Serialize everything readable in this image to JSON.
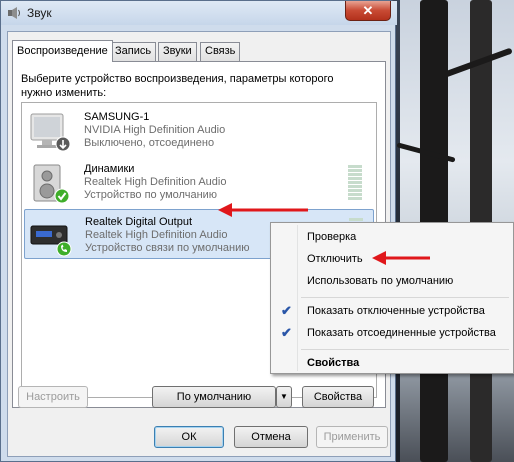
{
  "window": {
    "title": "Звук",
    "close_glyph": "✕"
  },
  "tabs": [
    {
      "label": "Воспроизведение"
    },
    {
      "label": "Запись"
    },
    {
      "label": "Звуки"
    },
    {
      "label": "Связь"
    }
  ],
  "panel": {
    "instruction": "Выберите устройство воспроизведения, параметры которого нужно изменить:"
  },
  "devices": [
    {
      "name": "SAMSUNG-1",
      "driver": "NVIDIA High Definition Audio",
      "status": "Выключено, отсоединено",
      "icon": "monitor-speaker-icon",
      "badge": "down-arrow-badge"
    },
    {
      "name": "Динамики",
      "driver": "Realtek High Definition Audio",
      "status": "Устройство по умолчанию",
      "icon": "speaker-icon",
      "badge": "green-check-badge"
    },
    {
      "name": "Realtek Digital Output",
      "driver": "Realtek High Definition Audio",
      "status": "Устройство связи по умолчанию",
      "icon": "digital-output-icon",
      "badge": "green-phone-badge"
    }
  ],
  "buttons": {
    "configure": "Настроить",
    "set_default": "По умолчанию",
    "dropdown_glyph": "▼",
    "properties": "Свойства",
    "ok": "ОК",
    "cancel": "Отмена",
    "apply": "Применить"
  },
  "context_menu": {
    "items": [
      {
        "label": "Проверка",
        "checked": false,
        "bold": false
      },
      {
        "label": "Отключить",
        "checked": false,
        "bold": false
      },
      {
        "label": "Использовать по умолчанию",
        "checked": false,
        "bold": false
      },
      {
        "label": "Показать отключенные устройства",
        "checked": true,
        "bold": false
      },
      {
        "label": "Показать отсоединенные устройства",
        "checked": true,
        "bold": false
      },
      {
        "label": "Свойства",
        "checked": false,
        "bold": true
      }
    ],
    "check_glyph": "✔"
  },
  "colors": {
    "accent_arrow": "#e0171b",
    "selection": "#d7e6f7",
    "check_green": "#3fae2a"
  }
}
